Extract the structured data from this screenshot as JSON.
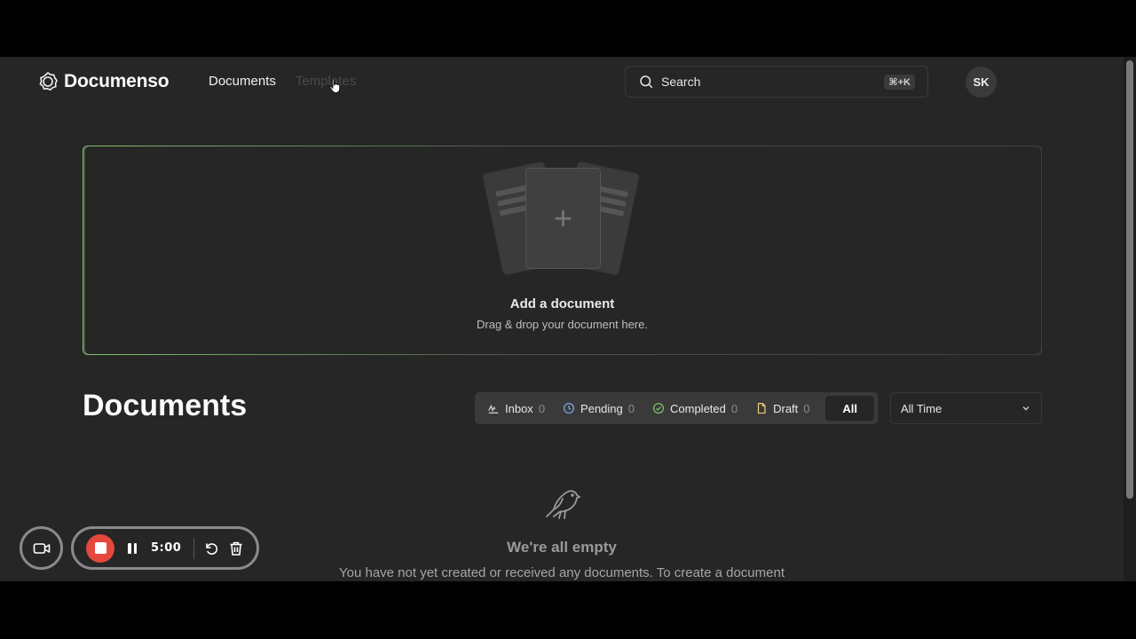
{
  "header": {
    "brand": "Documenso",
    "nav": [
      "Documents",
      "Templates"
    ],
    "search_label": "Search",
    "search_shortcut": "⌘+K",
    "avatar_initials": "SK"
  },
  "dropzone": {
    "title": "Add a document",
    "subtitle": "Drag & drop your document here."
  },
  "documents": {
    "title": "Documents",
    "tabs": [
      {
        "label": "Inbox",
        "count": "0"
      },
      {
        "label": "Pending",
        "count": "0"
      },
      {
        "label": "Completed",
        "count": "0"
      },
      {
        "label": "Draft",
        "count": "0"
      },
      {
        "label": "All"
      }
    ],
    "period": "All Time"
  },
  "empty": {
    "title": "We're all empty",
    "text": "You have not yet created or received any documents. To create a document"
  },
  "recorder": {
    "time": "5:00"
  },
  "colors": {
    "background": "#262626",
    "accent_green": "#7fc36f",
    "record_red": "#e5473d"
  }
}
